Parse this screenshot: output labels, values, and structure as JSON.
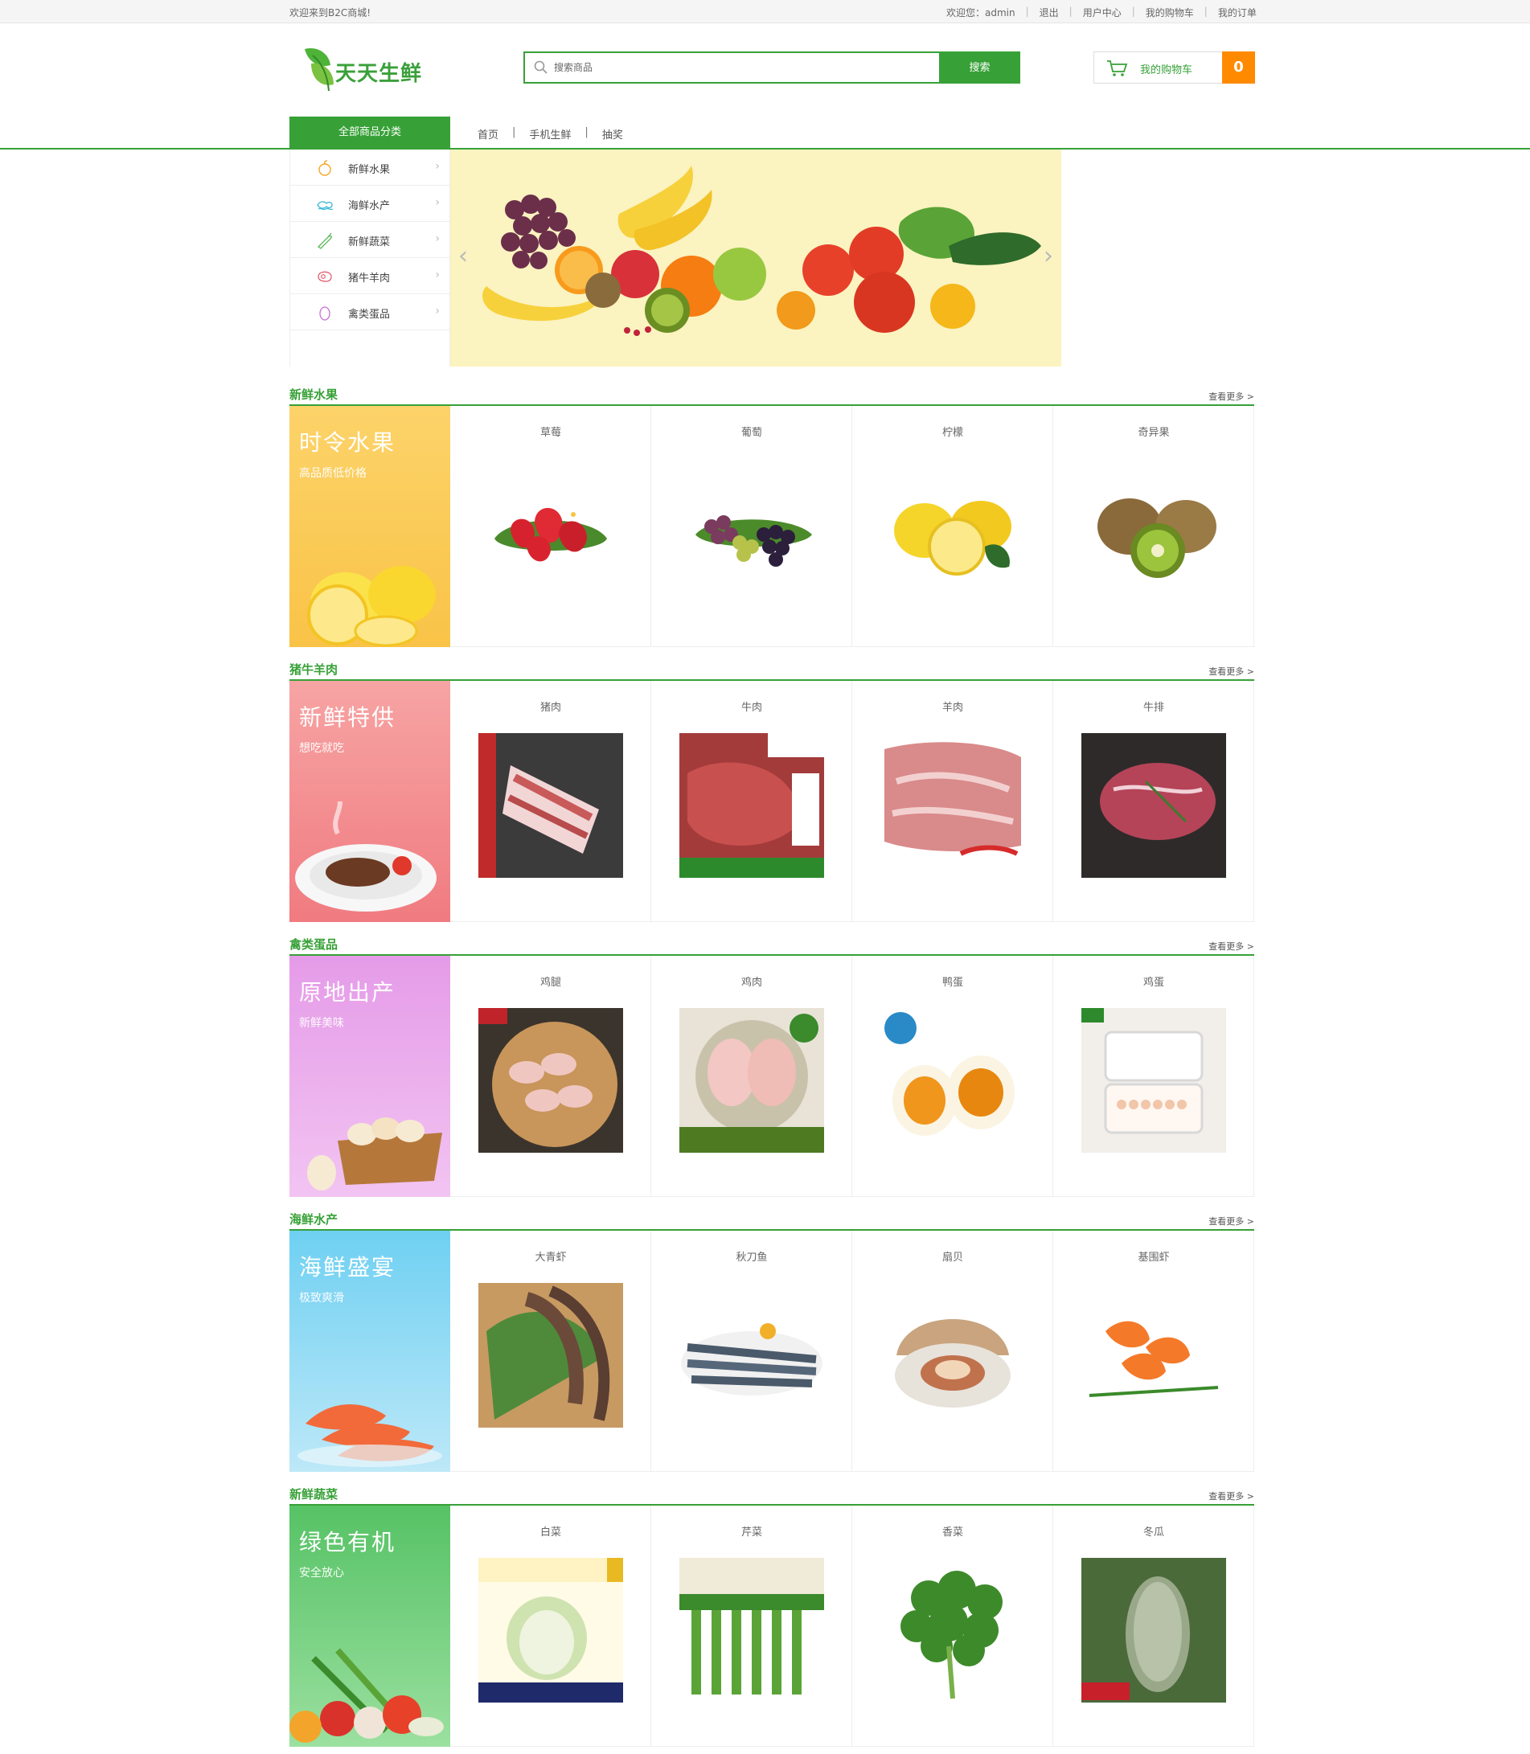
{
  "topbar": {
    "welcome": "欢迎来到B2C商城!",
    "user_greeting": "欢迎您：admin",
    "logout": "退出",
    "user_center": "用户中心",
    "my_cart": "我的购物车",
    "my_orders": "我的订单",
    "separator": "|"
  },
  "header": {
    "logo_text": "天天生鲜",
    "search_placeholder": "搜索商品",
    "search_button": "搜索",
    "cart_label": "我的购物车",
    "cart_count": "0"
  },
  "nav": {
    "all_categories": "全部商品分类",
    "links": [
      "首页",
      "手机生鲜",
      "抽奖"
    ],
    "separator": "|"
  },
  "side_menu": {
    "items": [
      {
        "label": "新鲜水果",
        "icon": "fruit-icon"
      },
      {
        "label": "海鲜水产",
        "icon": "seafood-icon"
      },
      {
        "label": "新鲜蔬菜",
        "icon": "vegetable-icon"
      },
      {
        "label": "猪牛羊肉",
        "icon": "meat-icon"
      },
      {
        "label": "禽类蛋品",
        "icon": "egg-icon"
      }
    ],
    "chevron": "›"
  },
  "banner": {
    "prev": "‹",
    "next": "›"
  },
  "sections": [
    {
      "title": "新鲜水果",
      "more": "查看更多 >",
      "promo_title": "时令水果",
      "promo_sub": "高品质低价格",
      "products": [
        "草莓",
        "葡萄",
        "柠檬",
        "奇异果"
      ]
    },
    {
      "title": "猪牛羊肉",
      "more": "查看更多 >",
      "promo_title": "新鲜特供",
      "promo_sub": "想吃就吃",
      "products": [
        "猪肉",
        "牛肉",
        "羊肉",
        "牛排"
      ]
    },
    {
      "title": "禽类蛋品",
      "more": "查看更多 >",
      "promo_title": "原地出产",
      "promo_sub": "新鲜美味",
      "products": [
        "鸡腿",
        "鸡肉",
        "鸭蛋",
        "鸡蛋"
      ]
    },
    {
      "title": "海鲜水产",
      "more": "查看更多 >",
      "promo_title": "海鲜盛宴",
      "promo_sub": "极致爽滑",
      "products": [
        "大青虾",
        "秋刀鱼",
        "扇贝",
        "基围虾"
      ]
    },
    {
      "title": "新鲜蔬菜",
      "more": "查看更多 >",
      "promo_title": "绿色有机",
      "promo_sub": "安全放心",
      "products": [
        "白菜",
        "芹菜",
        "香菜",
        "冬瓜"
      ]
    }
  ],
  "colors": {
    "brand_green": "#37a137",
    "cart_orange": "#ff8a00",
    "banner_bg": "#fbf3c0"
  }
}
